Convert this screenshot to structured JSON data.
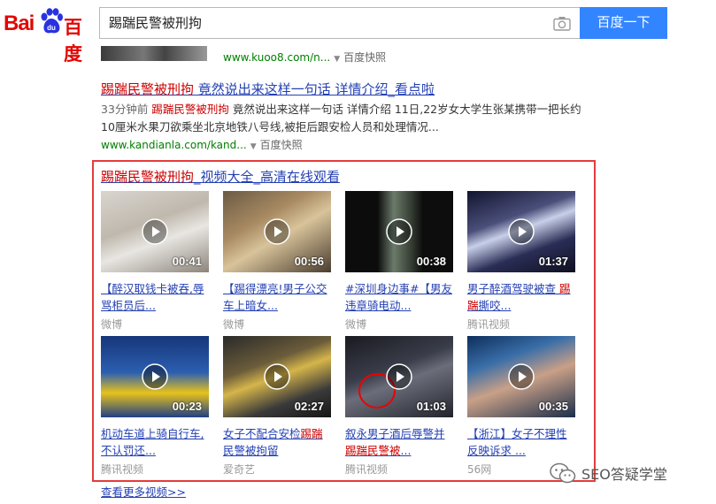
{
  "logo": {
    "part1": "Bai",
    "part2": "百度"
  },
  "search": {
    "query": "踢踹民警被刑拘",
    "button_label": "百度一下"
  },
  "results": [
    {
      "url": "www.kuoo8.com/n...",
      "snapshot": "百度快照"
    },
    {
      "title_red": "踢踹民警被刑拘",
      "title_rest": " 竟然说出来这样一句话 详情介绍_看点啦",
      "time": "33分钟前",
      "abstract_red": "踢踹民警被刑拘",
      "abstract_rest": " 竟然说出来这样一句话 详情介绍 11日,22岁女大学生张某携带一把长约10厘米水果刀欲乘坐北京地铁八号线,被拒后跟安检人员和处理情况...",
      "url": "www.kandianla.com/kand...",
      "snapshot": "百度快照"
    }
  ],
  "video_box": {
    "title_red": "踢踹民警被刑拘",
    "title_rest": "_视频大全_高清在线观看",
    "videos": [
      {
        "duration": "00:41",
        "title": "【醉汉取钱卡被吞,辱骂柜员后...",
        "source": "微博"
      },
      {
        "duration": "00:56",
        "title": "【踢得漂亮!男子公交车上暗女...",
        "source": "微博"
      },
      {
        "duration": "00:38",
        "title": "#深圳身边事#【男友违章骑电动...",
        "source": "微博"
      },
      {
        "duration": "01:37",
        "title": "男子醉酒驾驶被查 踢踹撕咬...",
        "title_red": "踢踹",
        "source": "腾讯视频"
      },
      {
        "duration": "00:23",
        "title": "机动车道上骑自行车,不认罚还...",
        "source": "腾讯视频"
      },
      {
        "duration": "02:27",
        "title_pre": "女子不配合安检",
        "title_red": "踢踹",
        "title_post": "民警被拘留",
        "source": "爱奇艺"
      },
      {
        "duration": "01:03",
        "title_pre": "叙永男子酒后辱警并",
        "title_red": "踢踹民警被",
        "title_post": "...",
        "source": "腾讯视频"
      },
      {
        "duration": "00:35",
        "title": "【浙江】女子不理性反映诉求 ...",
        "source": "56网"
      }
    ],
    "more_label": "查看更多视频>>"
  },
  "watermark": {
    "text": "SEO答疑学堂",
    "icon": "wechat-icon"
  },
  "colors": {
    "link": "#2440b3",
    "url_green": "#008000",
    "highlight": "#c00",
    "box_border": "#e43c3c",
    "button": "#3385ff"
  }
}
